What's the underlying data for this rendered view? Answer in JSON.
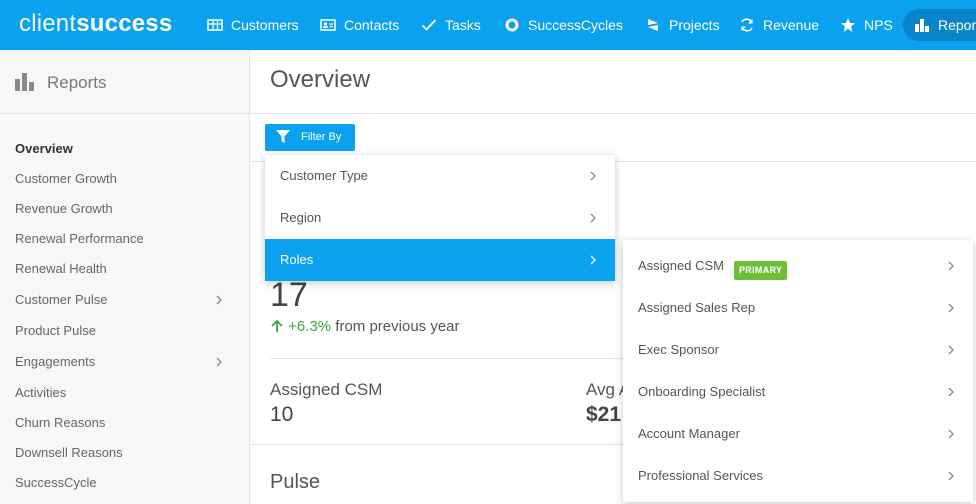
{
  "brand": {
    "light": "client",
    "bold": "success"
  },
  "nav": {
    "customers": "Customers",
    "contacts": "Contacts",
    "tasks": "Tasks",
    "successcycles": "SuccessCycles",
    "projects": "Projects",
    "revenue": "Revenue",
    "nps": "NPS",
    "reports": "Reports"
  },
  "sidebar": {
    "title": "Reports",
    "items": [
      {
        "label": "Overview"
      },
      {
        "label": "Customer Growth"
      },
      {
        "label": "Revenue Growth"
      },
      {
        "label": "Renewal Performance"
      },
      {
        "label": "Renewal Health"
      },
      {
        "label": "Customer Pulse"
      },
      {
        "label": "Product Pulse"
      },
      {
        "label": "Engagements"
      },
      {
        "label": "Activities"
      },
      {
        "label": "Churn Reasons"
      },
      {
        "label": "Downsell Reasons"
      },
      {
        "label": "SuccessCycle"
      }
    ]
  },
  "main": {
    "title": "Overview",
    "filter_label": "Filter By",
    "metric_value": "17",
    "change_pct": "+6.3%",
    "change_text": "from previous year",
    "stat1_label": "Assigned CSM",
    "stat1_value": "10",
    "stat2_label": "Avg A",
    "stat2_value": "$21",
    "pulse_title": "Pulse"
  },
  "filter_menu": {
    "items": [
      {
        "label": "Customer Type"
      },
      {
        "label": "Region"
      },
      {
        "label": "Roles"
      }
    ]
  },
  "roles_menu": {
    "primary_badge": "PRIMARY",
    "items": [
      {
        "label": "Assigned CSM"
      },
      {
        "label": "Assigned Sales Rep"
      },
      {
        "label": "Exec Sponsor"
      },
      {
        "label": "Onboarding Specialist"
      },
      {
        "label": "Account Manager"
      },
      {
        "label": "Professional Services"
      }
    ]
  },
  "colors": {
    "brand": "#0aa2ee",
    "nav_active": "#0a84c9",
    "positive": "#38a83a",
    "badge": "#6ec03a"
  }
}
